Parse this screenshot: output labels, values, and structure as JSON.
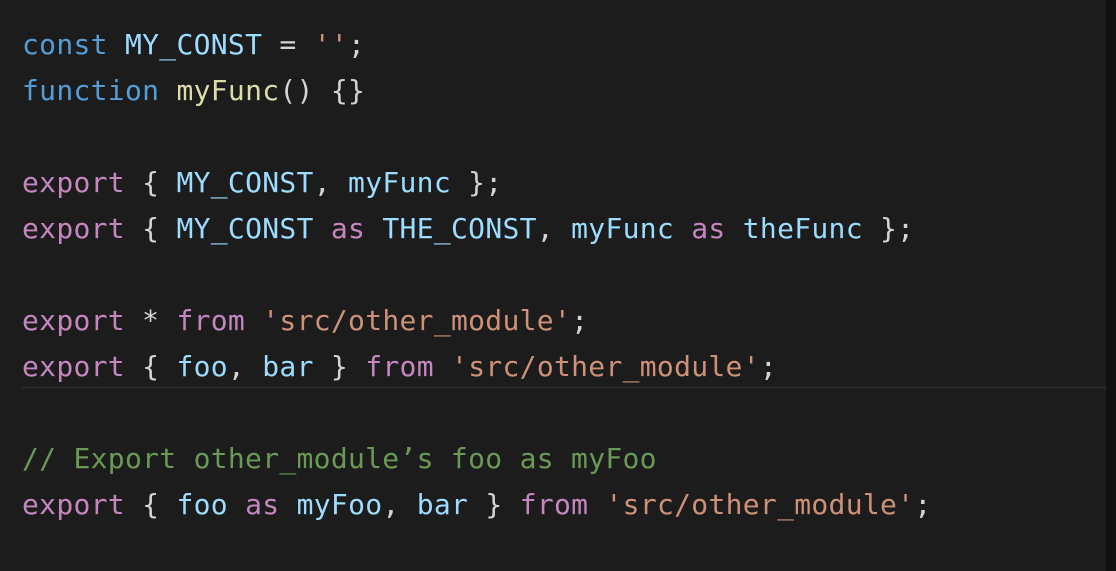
{
  "editor": {
    "colors": {
      "background": "#1c1c1c",
      "default": "#d4d4d4",
      "keyword_blue": "#569cd6",
      "keyword_pink": "#c586c0",
      "identifier": "#9cdcfe",
      "function_name": "#dcdcaa",
      "string": "#ce9178",
      "comment": "#6a9955"
    },
    "current_line": 7,
    "lines": [
      [
        {
          "t": "const",
          "c": "keyword_blue"
        },
        {
          "t": " "
        },
        {
          "t": "MY_CONST",
          "c": "identifier"
        },
        {
          "t": " = "
        },
        {
          "t": "''",
          "c": "string"
        },
        {
          "t": ";"
        }
      ],
      [
        {
          "t": "function",
          "c": "keyword_blue"
        },
        {
          "t": " "
        },
        {
          "t": "myFunc",
          "c": "function_name"
        },
        {
          "t": "() {}"
        }
      ],
      [],
      [
        {
          "t": "export",
          "c": "keyword_pink"
        },
        {
          "t": " { "
        },
        {
          "t": "MY_CONST",
          "c": "identifier"
        },
        {
          "t": ", "
        },
        {
          "t": "myFunc",
          "c": "identifier"
        },
        {
          "t": " };"
        }
      ],
      [
        {
          "t": "export",
          "c": "keyword_pink"
        },
        {
          "t": " { "
        },
        {
          "t": "MY_CONST",
          "c": "identifier"
        },
        {
          "t": " "
        },
        {
          "t": "as",
          "c": "keyword_pink"
        },
        {
          "t": " "
        },
        {
          "t": "THE_CONST",
          "c": "identifier"
        },
        {
          "t": ", "
        },
        {
          "t": "myFunc",
          "c": "identifier"
        },
        {
          "t": " "
        },
        {
          "t": "as",
          "c": "keyword_pink"
        },
        {
          "t": " "
        },
        {
          "t": "theFunc",
          "c": "identifier"
        },
        {
          "t": " };"
        }
      ],
      [],
      [
        {
          "t": "export",
          "c": "keyword_pink"
        },
        {
          "t": " * "
        },
        {
          "t": "from",
          "c": "keyword_pink"
        },
        {
          "t": " "
        },
        {
          "t": "'src/other_module'",
          "c": "string"
        },
        {
          "t": ";"
        }
      ],
      [
        {
          "t": "export",
          "c": "keyword_pink"
        },
        {
          "t": " { "
        },
        {
          "t": "foo",
          "c": "identifier"
        },
        {
          "t": ", "
        },
        {
          "t": "bar",
          "c": "identifier"
        },
        {
          "t": " } "
        },
        {
          "t": "from",
          "c": "keyword_pink"
        },
        {
          "t": " "
        },
        {
          "t": "'src/other_module'",
          "c": "string"
        },
        {
          "t": ";"
        }
      ],
      [],
      [
        {
          "t": "// Export other_module’s foo as myFoo",
          "c": "comment"
        }
      ],
      [
        {
          "t": "export",
          "c": "keyword_pink"
        },
        {
          "t": " { "
        },
        {
          "t": "foo",
          "c": "identifier"
        },
        {
          "t": " "
        },
        {
          "t": "as",
          "c": "keyword_pink"
        },
        {
          "t": " "
        },
        {
          "t": "myFoo",
          "c": "identifier"
        },
        {
          "t": ", "
        },
        {
          "t": "bar",
          "c": "identifier"
        },
        {
          "t": " } "
        },
        {
          "t": "from",
          "c": "keyword_pink"
        },
        {
          "t": " "
        },
        {
          "t": "'src/other_module'",
          "c": "string"
        },
        {
          "t": ";"
        }
      ]
    ]
  }
}
